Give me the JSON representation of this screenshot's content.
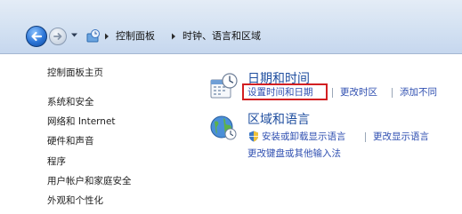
{
  "address_bar": {
    "breadcrumb": [
      "控制面板",
      "时钟、语言和区域"
    ]
  },
  "sidebar": {
    "items": [
      {
        "label": "控制面板主页"
      },
      {
        "label": "系统和安全"
      },
      {
        "label": "网络和 Internet"
      },
      {
        "label": "硬件和声音"
      },
      {
        "label": "程序"
      },
      {
        "label": "用户帐户和家庭安全"
      },
      {
        "label": "外观和个性化"
      }
    ]
  },
  "categories": [
    {
      "title": "日期和时间",
      "icon": "calendar-clock-icon",
      "links": [
        "设置时间和日期",
        "更改时区",
        "添加不同"
      ]
    },
    {
      "title": "区域和语言",
      "icon": "globe-clock-icon",
      "links": [
        "安装或卸载显示语言",
        "更改显示语言",
        "更改键盘或其他输入法"
      ],
      "shield_icon": "uac-shield-icon"
    }
  ],
  "colors": {
    "link": "#2e4eb0",
    "title": "#1f4e9f",
    "highlight": "#d21f22"
  }
}
